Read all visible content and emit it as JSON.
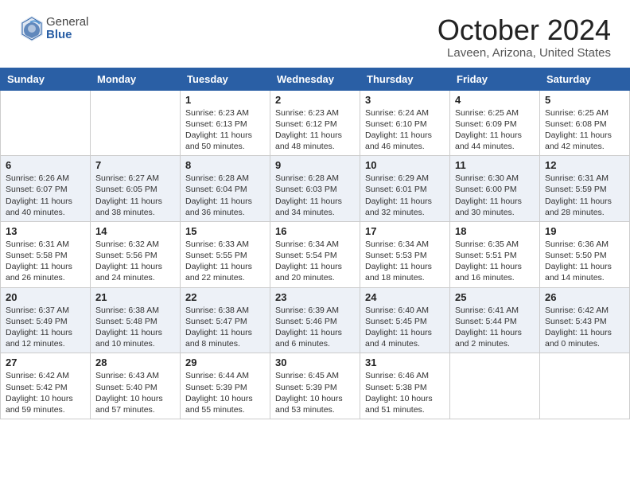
{
  "logo": {
    "general": "General",
    "blue": "Blue"
  },
  "title": "October 2024",
  "location": "Laveen, Arizona, United States",
  "days_of_week": [
    "Sunday",
    "Monday",
    "Tuesday",
    "Wednesday",
    "Thursday",
    "Friday",
    "Saturday"
  ],
  "weeks": [
    [
      {
        "day": "",
        "sunrise": "",
        "sunset": "",
        "daylight": ""
      },
      {
        "day": "",
        "sunrise": "",
        "sunset": "",
        "daylight": ""
      },
      {
        "day": "1",
        "sunrise": "Sunrise: 6:23 AM",
        "sunset": "Sunset: 6:13 PM",
        "daylight": "Daylight: 11 hours and 50 minutes."
      },
      {
        "day": "2",
        "sunrise": "Sunrise: 6:23 AM",
        "sunset": "Sunset: 6:12 PM",
        "daylight": "Daylight: 11 hours and 48 minutes."
      },
      {
        "day": "3",
        "sunrise": "Sunrise: 6:24 AM",
        "sunset": "Sunset: 6:10 PM",
        "daylight": "Daylight: 11 hours and 46 minutes."
      },
      {
        "day": "4",
        "sunrise": "Sunrise: 6:25 AM",
        "sunset": "Sunset: 6:09 PM",
        "daylight": "Daylight: 11 hours and 44 minutes."
      },
      {
        "day": "5",
        "sunrise": "Sunrise: 6:25 AM",
        "sunset": "Sunset: 6:08 PM",
        "daylight": "Daylight: 11 hours and 42 minutes."
      }
    ],
    [
      {
        "day": "6",
        "sunrise": "Sunrise: 6:26 AM",
        "sunset": "Sunset: 6:07 PM",
        "daylight": "Daylight: 11 hours and 40 minutes."
      },
      {
        "day": "7",
        "sunrise": "Sunrise: 6:27 AM",
        "sunset": "Sunset: 6:05 PM",
        "daylight": "Daylight: 11 hours and 38 minutes."
      },
      {
        "day": "8",
        "sunrise": "Sunrise: 6:28 AM",
        "sunset": "Sunset: 6:04 PM",
        "daylight": "Daylight: 11 hours and 36 minutes."
      },
      {
        "day": "9",
        "sunrise": "Sunrise: 6:28 AM",
        "sunset": "Sunset: 6:03 PM",
        "daylight": "Daylight: 11 hours and 34 minutes."
      },
      {
        "day": "10",
        "sunrise": "Sunrise: 6:29 AM",
        "sunset": "Sunset: 6:01 PM",
        "daylight": "Daylight: 11 hours and 32 minutes."
      },
      {
        "day": "11",
        "sunrise": "Sunrise: 6:30 AM",
        "sunset": "Sunset: 6:00 PM",
        "daylight": "Daylight: 11 hours and 30 minutes."
      },
      {
        "day": "12",
        "sunrise": "Sunrise: 6:31 AM",
        "sunset": "Sunset: 5:59 PM",
        "daylight": "Daylight: 11 hours and 28 minutes."
      }
    ],
    [
      {
        "day": "13",
        "sunrise": "Sunrise: 6:31 AM",
        "sunset": "Sunset: 5:58 PM",
        "daylight": "Daylight: 11 hours and 26 minutes."
      },
      {
        "day": "14",
        "sunrise": "Sunrise: 6:32 AM",
        "sunset": "Sunset: 5:56 PM",
        "daylight": "Daylight: 11 hours and 24 minutes."
      },
      {
        "day": "15",
        "sunrise": "Sunrise: 6:33 AM",
        "sunset": "Sunset: 5:55 PM",
        "daylight": "Daylight: 11 hours and 22 minutes."
      },
      {
        "day": "16",
        "sunrise": "Sunrise: 6:34 AM",
        "sunset": "Sunset: 5:54 PM",
        "daylight": "Daylight: 11 hours and 20 minutes."
      },
      {
        "day": "17",
        "sunrise": "Sunrise: 6:34 AM",
        "sunset": "Sunset: 5:53 PM",
        "daylight": "Daylight: 11 hours and 18 minutes."
      },
      {
        "day": "18",
        "sunrise": "Sunrise: 6:35 AM",
        "sunset": "Sunset: 5:51 PM",
        "daylight": "Daylight: 11 hours and 16 minutes."
      },
      {
        "day": "19",
        "sunrise": "Sunrise: 6:36 AM",
        "sunset": "Sunset: 5:50 PM",
        "daylight": "Daylight: 11 hours and 14 minutes."
      }
    ],
    [
      {
        "day": "20",
        "sunrise": "Sunrise: 6:37 AM",
        "sunset": "Sunset: 5:49 PM",
        "daylight": "Daylight: 11 hours and 12 minutes."
      },
      {
        "day": "21",
        "sunrise": "Sunrise: 6:38 AM",
        "sunset": "Sunset: 5:48 PM",
        "daylight": "Daylight: 11 hours and 10 minutes."
      },
      {
        "day": "22",
        "sunrise": "Sunrise: 6:38 AM",
        "sunset": "Sunset: 5:47 PM",
        "daylight": "Daylight: 11 hours and 8 minutes."
      },
      {
        "day": "23",
        "sunrise": "Sunrise: 6:39 AM",
        "sunset": "Sunset: 5:46 PM",
        "daylight": "Daylight: 11 hours and 6 minutes."
      },
      {
        "day": "24",
        "sunrise": "Sunrise: 6:40 AM",
        "sunset": "Sunset: 5:45 PM",
        "daylight": "Daylight: 11 hours and 4 minutes."
      },
      {
        "day": "25",
        "sunrise": "Sunrise: 6:41 AM",
        "sunset": "Sunset: 5:44 PM",
        "daylight": "Daylight: 11 hours and 2 minutes."
      },
      {
        "day": "26",
        "sunrise": "Sunrise: 6:42 AM",
        "sunset": "Sunset: 5:43 PM",
        "daylight": "Daylight: 11 hours and 0 minutes."
      }
    ],
    [
      {
        "day": "27",
        "sunrise": "Sunrise: 6:42 AM",
        "sunset": "Sunset: 5:42 PM",
        "daylight": "Daylight: 10 hours and 59 minutes."
      },
      {
        "day": "28",
        "sunrise": "Sunrise: 6:43 AM",
        "sunset": "Sunset: 5:40 PM",
        "daylight": "Daylight: 10 hours and 57 minutes."
      },
      {
        "day": "29",
        "sunrise": "Sunrise: 6:44 AM",
        "sunset": "Sunset: 5:39 PM",
        "daylight": "Daylight: 10 hours and 55 minutes."
      },
      {
        "day": "30",
        "sunrise": "Sunrise: 6:45 AM",
        "sunset": "Sunset: 5:39 PM",
        "daylight": "Daylight: 10 hours and 53 minutes."
      },
      {
        "day": "31",
        "sunrise": "Sunrise: 6:46 AM",
        "sunset": "Sunset: 5:38 PM",
        "daylight": "Daylight: 10 hours and 51 minutes."
      },
      {
        "day": "",
        "sunrise": "",
        "sunset": "",
        "daylight": ""
      },
      {
        "day": "",
        "sunrise": "",
        "sunset": "",
        "daylight": ""
      }
    ]
  ]
}
